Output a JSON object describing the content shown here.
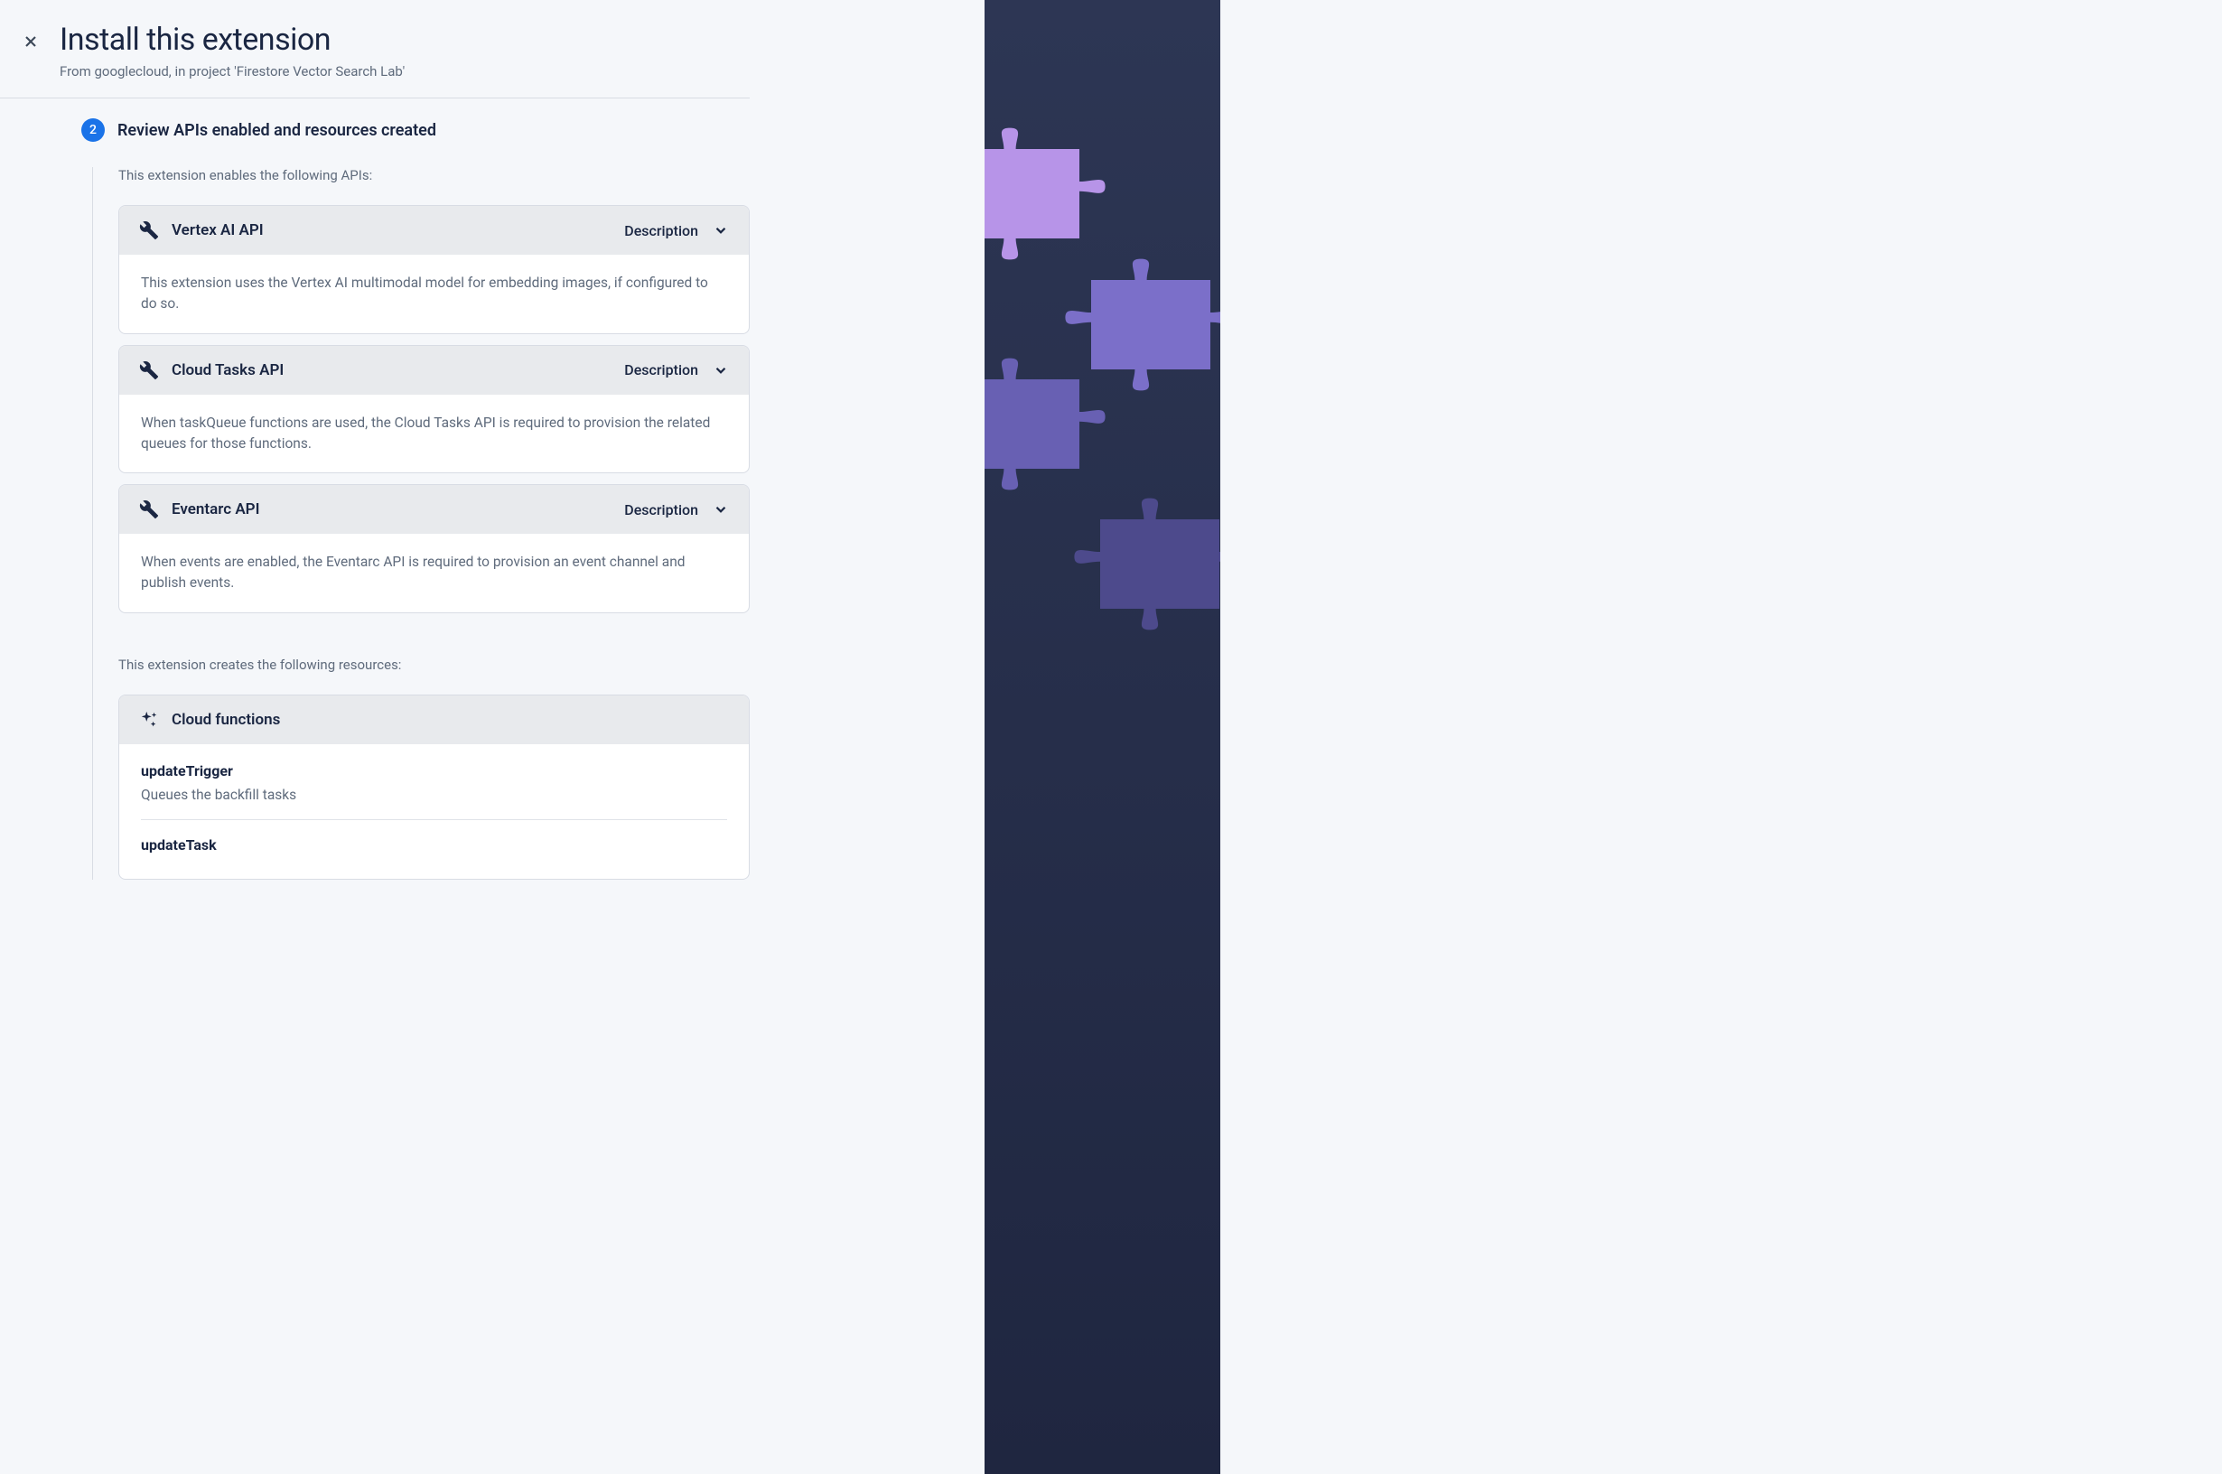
{
  "header": {
    "title": "Install this extension",
    "subtitle": "From googlecloud, in project 'Firestore Vector Search Lab'"
  },
  "step": {
    "number": "2",
    "title": "Review APIs enabled and resources created"
  },
  "apis": {
    "intro": "This extension enables the following APIs:",
    "description_label": "Description",
    "items": [
      {
        "name": "Vertex AI API",
        "description": "This extension uses the Vertex AI multimodal model for embedding images, if configured to do so."
      },
      {
        "name": "Cloud Tasks API",
        "description": "When taskQueue functions are used, the Cloud Tasks API is required to provision the related queues for those functions."
      },
      {
        "name": "Eventarc API",
        "description": "When events are enabled, the Eventarc API is required to provision an event channel and publish events."
      }
    ]
  },
  "resources": {
    "intro": "This extension creates the following resources:",
    "title": "Cloud functions",
    "functions": [
      {
        "name": "updateTrigger",
        "description": "Queues the backfill tasks"
      },
      {
        "name": "updateTask",
        "description": ""
      }
    ]
  }
}
